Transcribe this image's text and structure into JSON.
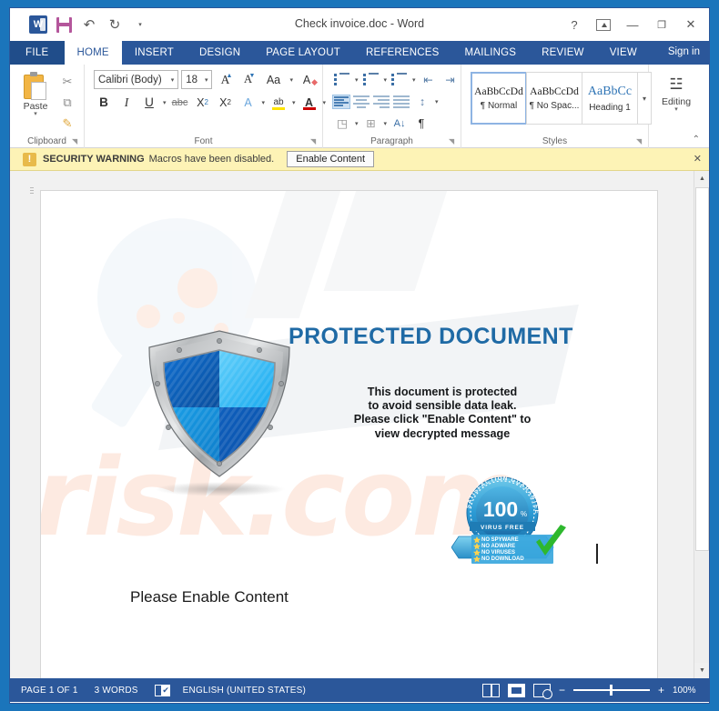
{
  "window": {
    "title": "Check invoice.doc - Word",
    "quick_access": [
      {
        "name": "word-logo",
        "label": "W"
      },
      {
        "name": "save-icon",
        "label": ""
      },
      {
        "name": "undo-icon",
        "label": "↶"
      },
      {
        "name": "redo-icon",
        "label": "↻"
      },
      {
        "name": "customize-qat-icon",
        "label": "▾"
      }
    ],
    "controls": {
      "help": "?",
      "ribbon_display_options": "",
      "minimize": "—",
      "restore": "❐",
      "close": "✕"
    }
  },
  "ribbon": {
    "file_tab": "FILE",
    "tabs": [
      {
        "label": "HOME",
        "active": true
      },
      {
        "label": "INSERT",
        "active": false
      },
      {
        "label": "DESIGN",
        "active": false
      },
      {
        "label": "PAGE LAYOUT",
        "active": false
      },
      {
        "label": "REFERENCES",
        "active": false
      },
      {
        "label": "MAILINGS",
        "active": false
      },
      {
        "label": "REVIEW",
        "active": false
      },
      {
        "label": "VIEW",
        "active": false
      }
    ],
    "sign_in": "Sign in",
    "collapse": "⌃",
    "groups": {
      "clipboard": {
        "label": "Clipboard",
        "paste": "Paste",
        "paste_caret": "▾",
        "cut": "✂",
        "copy": "⧉",
        "format_painter": "✎"
      },
      "font": {
        "label": "Font",
        "font_name": "Calibri (Body)",
        "font_size": "18",
        "grow_font": "A",
        "shrink_font": "A",
        "change_case": "Aa",
        "clear_formatting": "A",
        "bold": "B",
        "italic": "I",
        "underline": "U",
        "strikethrough": "abc",
        "subscript": "X",
        "subscript_num": "2",
        "superscript": "X",
        "superscript_num": "2",
        "text_effects": "A",
        "highlight": "ab",
        "font_color": "A",
        "caret": "▾"
      },
      "paragraph": {
        "label": "Paragraph",
        "bullets": "bullets-icon",
        "numbering": "numbering-icon",
        "multilevel": "multilevel-list-icon",
        "decrease_indent": "⇤",
        "increase_indent": "⇥",
        "align_left": "align-left-icon",
        "align_center": "align-center-icon",
        "align_right": "align-right-icon",
        "justify": "justify-icon",
        "line_spacing": "↕",
        "shading": "◳",
        "borders": "⊞",
        "sort": "A↓",
        "show_marks": "¶"
      },
      "styles": {
        "label": "Styles",
        "items": [
          {
            "preview": "AaBbCcDd",
            "name": "¶ Normal",
            "active": true
          },
          {
            "preview": "AaBbCcDd",
            "name": "¶ No Spac...",
            "active": false
          },
          {
            "preview": "AaBbCc",
            "name": "Heading 1",
            "active": false
          }
        ],
        "more": "▾"
      },
      "editing": {
        "label": "Editing",
        "button": "Editing",
        "caret": "▾",
        "icon": "☳"
      }
    }
  },
  "security_bar": {
    "icon": "!",
    "title": "SECURITY WARNING",
    "message": "Macros have been disabled.",
    "button": "Enable Content",
    "close": "✕"
  },
  "document": {
    "heading": "PROTECTED DOCUMENT",
    "body_lines": [
      "This document is protected",
      "to avoid sensible data leak.",
      "Please click \"Enable Content\" to",
      "view decrypted message"
    ],
    "footer_text": "Please Enable Content",
    "watermark_text": "risk.com",
    "seal": {
      "arc_text": "SATISFACTION GUARANTEED",
      "percent": "100",
      "percent_sign": "%",
      "ribbon_text": "VIRUS FREE",
      "list": [
        "NO SPYWARE",
        "NO ADWARE",
        "NO VIRUSES",
        "NO DOWNLOAD"
      ]
    },
    "colors": {
      "heading": "#1f6aa5",
      "shield_blue": "#1b84e0",
      "shield_light": "#4fc3f7",
      "seal_blue": "#2e9fd8"
    }
  },
  "scrollbar": {
    "up": "▲",
    "down": "▼"
  },
  "status_bar": {
    "page": "PAGE 1 OF 1",
    "words": "3 WORDS",
    "proofing": "✔",
    "language": "ENGLISH (UNITED STATES)",
    "views": {
      "read_mode": "read-mode-icon",
      "print_layout": "print-layout-icon",
      "web_layout": "web-layout-icon"
    },
    "zoom_out": "−",
    "zoom_in": "+",
    "zoom_level": "100%"
  }
}
